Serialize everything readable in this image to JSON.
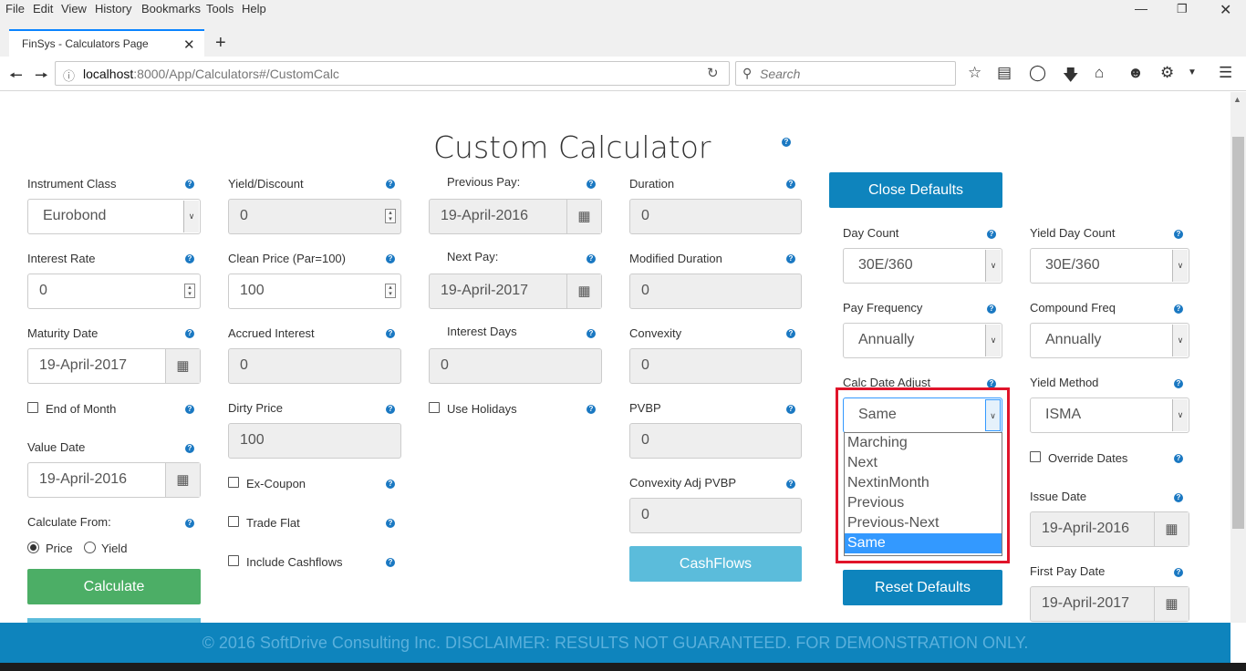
{
  "browser": {
    "menu": [
      "File",
      "Edit",
      "View",
      "History",
      "Bookmarks",
      "Tools",
      "Help"
    ],
    "tab_title": "FinSys - Calculators Page",
    "url_host": "localhost",
    "url_rest": ":8000/App/Calculators#/CustomCalc",
    "search_placeholder": "Search"
  },
  "page": {
    "title": "Custom Calculator",
    "help_glyph": "?"
  },
  "col1": {
    "instrument_class_label": "Instrument Class",
    "instrument_class_value": "Eurobond",
    "interest_rate_label": "Interest Rate",
    "interest_rate_value": "0",
    "maturity_date_label": "Maturity Date",
    "maturity_date_value": "19-April-2017",
    "end_of_month_label": "End of Month",
    "value_date_label": "Value Date",
    "value_date_value": "19-April-2016",
    "calculate_from_label": "Calculate From:",
    "price_label": "Price",
    "yield_label": "Yield",
    "calculate_button": "Calculate"
  },
  "col2": {
    "yield_discount_label": "Yield/Discount",
    "yield_discount_value": "0",
    "clean_price_label": "Clean Price (Par=100)",
    "clean_price_value": "100",
    "accrued_interest_label": "Accrued Interest",
    "accrued_interest_value": "0",
    "dirty_price_label": "Dirty Price",
    "dirty_price_value": "100",
    "ex_coupon_label": "Ex-Coupon",
    "trade_flat_label": "Trade Flat",
    "include_cashflows_label": "Include Cashflows"
  },
  "col3": {
    "previous_pay_label": "Previous Pay:",
    "previous_pay_value": "19-April-2016",
    "next_pay_label": "Next Pay:",
    "next_pay_value": "19-April-2017",
    "interest_days_label": "Interest Days",
    "interest_days_value": "0",
    "use_holidays_label": "Use Holidays"
  },
  "col4": {
    "duration_label": "Duration",
    "duration_value": "0",
    "modified_duration_label": "Modified Duration",
    "modified_duration_value": "0",
    "convexity_label": "Convexity",
    "convexity_value": "0",
    "pvbp_label": "PVBP",
    "pvbp_value": "0",
    "convexity_adj_label": "Convexity Adj PVBP",
    "convexity_adj_value": "0",
    "cashflows_button": "CashFlows"
  },
  "defaults": {
    "close_button": "Close Defaults",
    "day_count_label": "Day Count",
    "day_count_value": "30E/360",
    "yield_day_count_label": "Yield Day Count",
    "yield_day_count_value": "30E/360",
    "pay_frequency_label": "Pay Frequency",
    "pay_frequency_value": "Annually",
    "compound_freq_label": "Compound Freq",
    "compound_freq_value": "Annually",
    "calc_date_adjust_label": "Calc Date Adjust",
    "calc_date_adjust_value": "Same",
    "calc_date_adjust_options": [
      "Marching",
      "Next",
      "NextinMonth",
      "Previous",
      "Previous-Next",
      "Same"
    ],
    "yield_method_label": "Yield Method",
    "yield_method_value": "ISMA",
    "override_dates_label": "Override Dates",
    "issue_date_label": "Issue Date",
    "issue_date_value": "19-April-2016",
    "first_pay_date_label": "First Pay Date",
    "first_pay_date_value": "19-April-2017",
    "reset_button": "Reset Defaults"
  },
  "footer": "© 2016 SoftDrive Consulting Inc. DISCLAIMER: RESULTS NOT GUARANTEED. FOR DEMONSTRATION ONLY."
}
